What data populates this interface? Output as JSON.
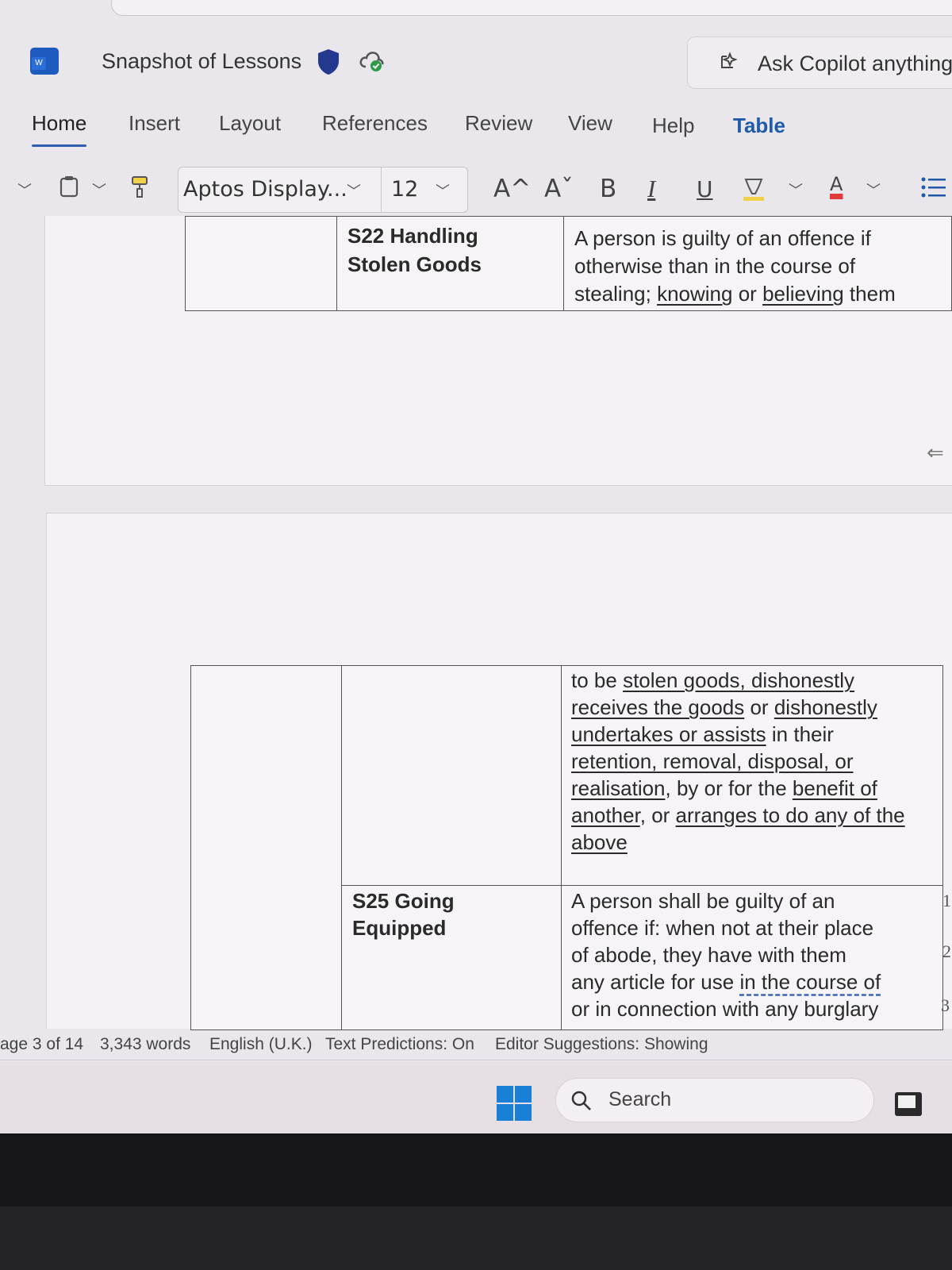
{
  "app": {
    "title": "Snapshot of Lessons",
    "logo_letter": "W",
    "copilot_placeholder": "Ask Copilot anything"
  },
  "tabs": [
    {
      "label": "Home"
    },
    {
      "label": "Insert"
    },
    {
      "label": "Layout"
    },
    {
      "label": "References"
    },
    {
      "label": "Review"
    },
    {
      "label": "View"
    },
    {
      "label": "Help"
    },
    {
      "label": "Table"
    }
  ],
  "toolbar": {
    "font_name": "Aptos Display...",
    "font_size": "12",
    "grow_font": "A^",
    "shrink_font": "Aˇ",
    "bold": "B",
    "italic": "I",
    "underline": "U",
    "font_color_letter": "A",
    "highlight_color": "#f2d14a",
    "font_color": "#e03a3a"
  },
  "document": {
    "table1": {
      "offence": [
        "S22 Handling",
        "Stolen Goods"
      ],
      "definition_lines": [
        "A person is guilty of an offence if",
        "otherwise than in the course of"
      ],
      "line3_prefix": "stealing; ",
      "line3_u1": "knowing",
      "line3_mid": " or ",
      "line3_u2": "believing",
      "line3_suffix": " them"
    },
    "table2": {
      "cont_l1_prefix": "to be ",
      "cont_l1_u": "stolen goods, dishonestly",
      "cont_l2_u1": "receives the goods",
      "cont_l2_mid": " or ",
      "cont_l2_u2": "dishonestly",
      "cont_l3_u": "undertakes or assists",
      "cont_l3_suffix": " in their",
      "cont_l4_u": "retention, removal, disposal, or",
      "cont_l5_u": "realisation",
      "cont_l5_mid": ", by or for the ",
      "cont_l5_u2": "benefit of",
      "cont_l6_u": "another",
      "cont_l6_mid": ", or ",
      "cont_l6_u2": "arranges to do any of the",
      "cont_l7_u": "above",
      "offence2": [
        "S25 Going",
        "Equipped"
      ],
      "def2_lines": [
        "A person shall be guilty of an",
        "offence if: when not at their place",
        "of abode, they have with them"
      ],
      "def2_l4_prefix": "any article for use ",
      "def2_l4_dash": "in the course of",
      "def2_l5": "or in connection with any burglary"
    },
    "margin_numbers": [
      "1",
      "2",
      "3"
    ]
  },
  "status": {
    "page": "age 3 of 14",
    "words": "3,343 words",
    "language": "English (U.K.)",
    "predictions": "Text Predictions: On",
    "editor": "Editor Suggestions: Showing"
  },
  "taskbar": {
    "search_label": "Search"
  },
  "icons": [
    "word-logo-icon",
    "shield-icon",
    "cloud-sync-icon",
    "copilot-icon",
    "clipboard-icon",
    "format-painter-icon",
    "highlighter-icon",
    "font-color-icon",
    "list-icon",
    "arrow-left-icon",
    "windows-start-icon",
    "search-icon",
    "tv-app-icon"
  ]
}
